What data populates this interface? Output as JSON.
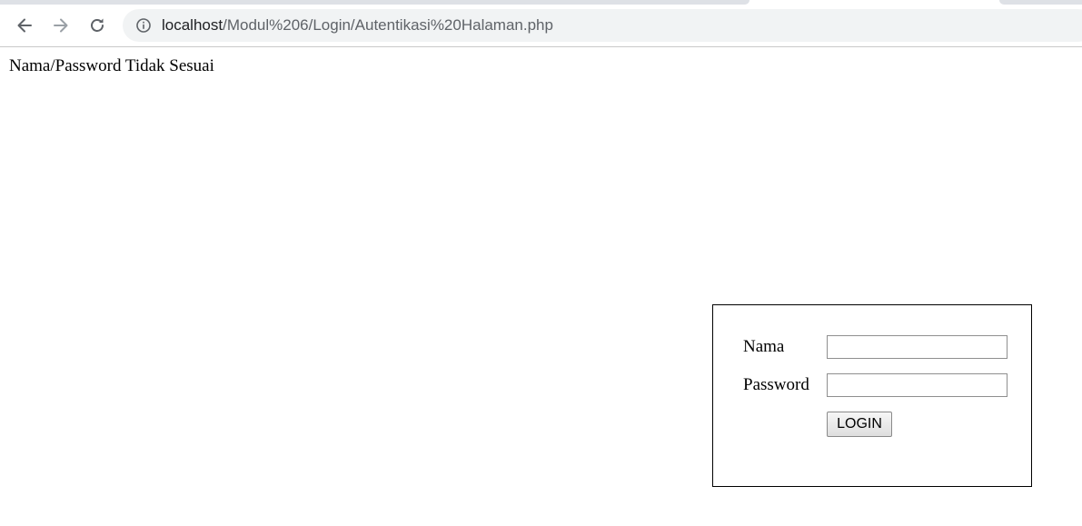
{
  "browser": {
    "icons": {
      "back": "arrow-left-icon",
      "forward": "arrow-right-icon",
      "reload": "reload-icon",
      "site_info": "info-icon"
    },
    "address_bar": {
      "host": "localhost",
      "path": "/Modul%206/Login/Autentikasi%20Halaman.php"
    }
  },
  "page": {
    "error_message": "Nama/Password Tidak Sesuai",
    "login_form": {
      "nama_label": "Nama",
      "nama_value": "",
      "password_label": "Password",
      "password_value": "",
      "submit_label": "LOGIN"
    }
  },
  "colors": {
    "chrome_background": "#dee1e6",
    "omnibox_background": "#f1f3f4",
    "url_host": "#202124",
    "url_path": "#5f6368",
    "forward_disabled": "#9aa0a6"
  }
}
